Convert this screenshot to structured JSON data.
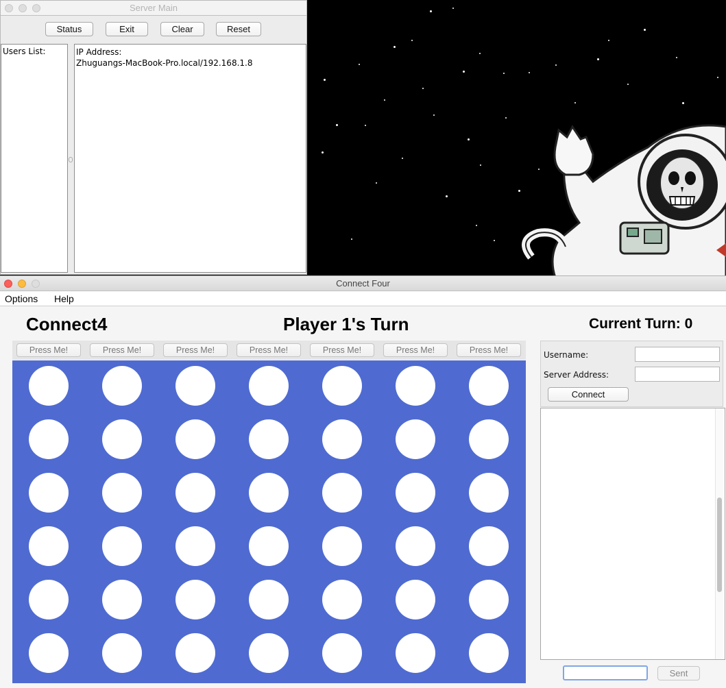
{
  "desktop": {
    "wallpaper_icon": "astronaut-skeleton-illustration"
  },
  "server_window": {
    "title": "Server Main",
    "buttons": [
      "Status",
      "Exit",
      "Clear",
      "Reset"
    ],
    "users_label": "Users List:",
    "log_lines": [
      "IP Address:",
      "Zhuguangs-MacBook-Pro.local/192.168.1.8"
    ]
  },
  "game_window": {
    "title": "Connect Four",
    "menu": [
      "Options",
      "Help"
    ],
    "heading": "Connect4",
    "turn_status": "Player 1's Turn",
    "current_turn_label": "Current Turn: 0",
    "column_buttons": [
      "Press Me!",
      "Press Me!",
      "Press Me!",
      "Press Me!",
      "Press Me!",
      "Press Me!",
      "Press Me!"
    ],
    "board": {
      "rows": 6,
      "columns": 7,
      "board_color": "#4f6bd1",
      "empty_color": "#ffffff"
    },
    "connection": {
      "username_label": "Username:",
      "username_value": "",
      "server_label": "Server Address:",
      "server_value": "",
      "connect_label": "Connect"
    },
    "chat": {
      "message_value": "",
      "send_label": "Sent"
    }
  }
}
